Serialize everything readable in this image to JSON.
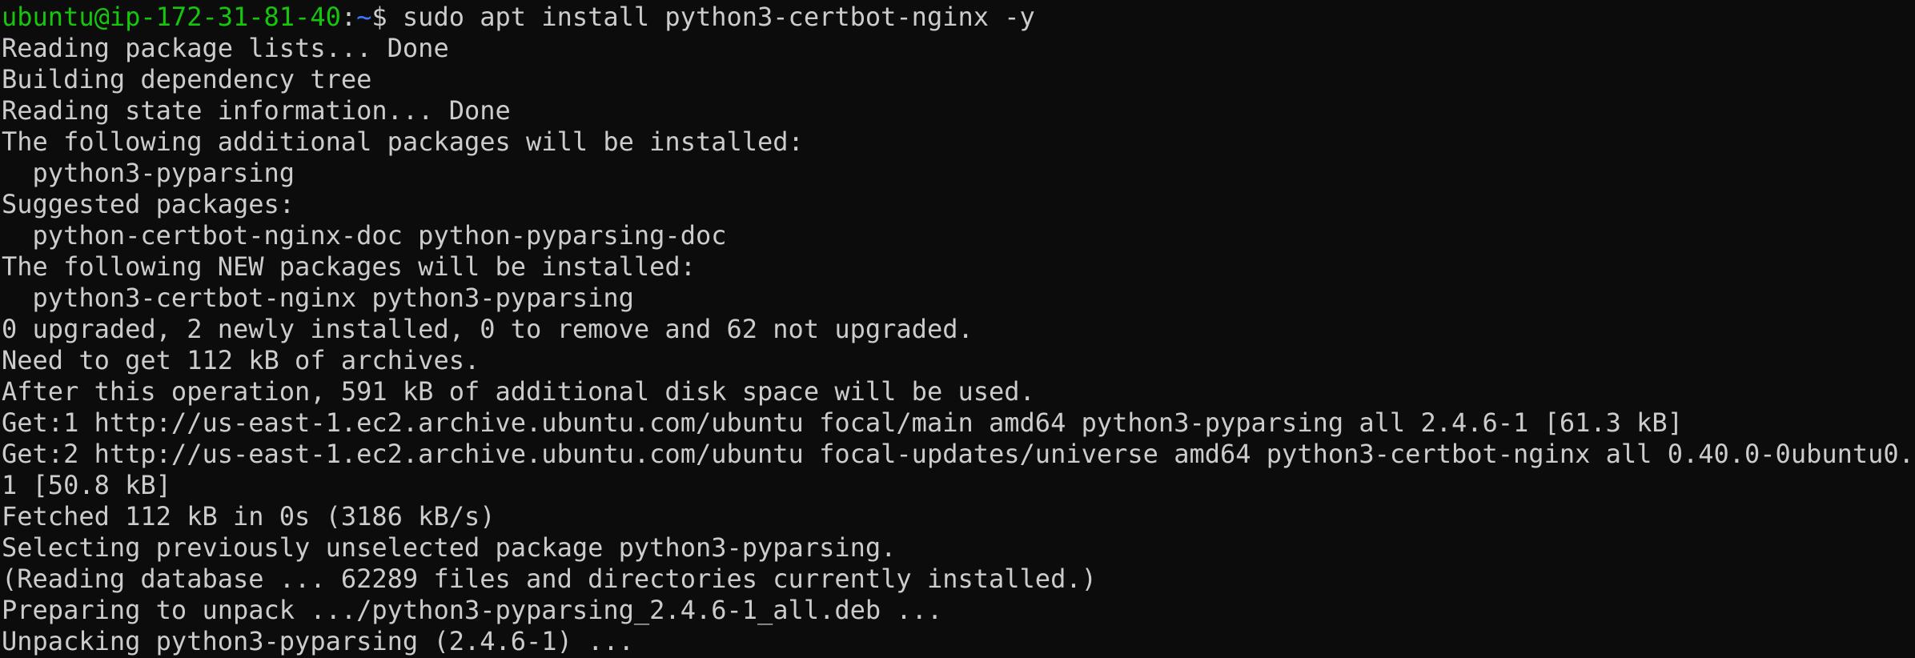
{
  "terminal": {
    "prompt": {
      "user_host": "ubuntu@ip-172-31-81-40",
      "separator": ":",
      "path": "~",
      "symbol": "$ ",
      "command": "sudo apt install python3-certbot-nginx -y"
    },
    "output": [
      "Reading package lists... Done",
      "Building dependency tree",
      "Reading state information... Done",
      "The following additional packages will be installed:",
      "  python3-pyparsing",
      "Suggested packages:",
      "  python-certbot-nginx-doc python-pyparsing-doc",
      "The following NEW packages will be installed:",
      "  python3-certbot-nginx python3-pyparsing",
      "0 upgraded, 2 newly installed, 0 to remove and 62 not upgraded.",
      "Need to get 112 kB of archives.",
      "After this operation, 591 kB of additional disk space will be used.",
      "Get:1 http://us-east-1.ec2.archive.ubuntu.com/ubuntu focal/main amd64 python3-pyparsing all 2.4.6-1 [61.3 kB]",
      "Get:2 http://us-east-1.ec2.archive.ubuntu.com/ubuntu focal-updates/universe amd64 python3-certbot-nginx all 0.40.0-0ubuntu0.",
      "1 [50.8 kB]",
      "Fetched 112 kB in 0s (3186 kB/s)",
      "Selecting previously unselected package python3-pyparsing.",
      "(Reading database ... 62289 files and directories currently installed.)",
      "Preparing to unpack .../python3-pyparsing_2.4.6-1_all.deb ...",
      "Unpacking python3-pyparsing (2.4.6-1) ..."
    ]
  },
  "colors": {
    "background": "#0c0c0c",
    "foreground": "#cccccc",
    "user_host": "#16c60c",
    "path": "#3b78ff"
  }
}
